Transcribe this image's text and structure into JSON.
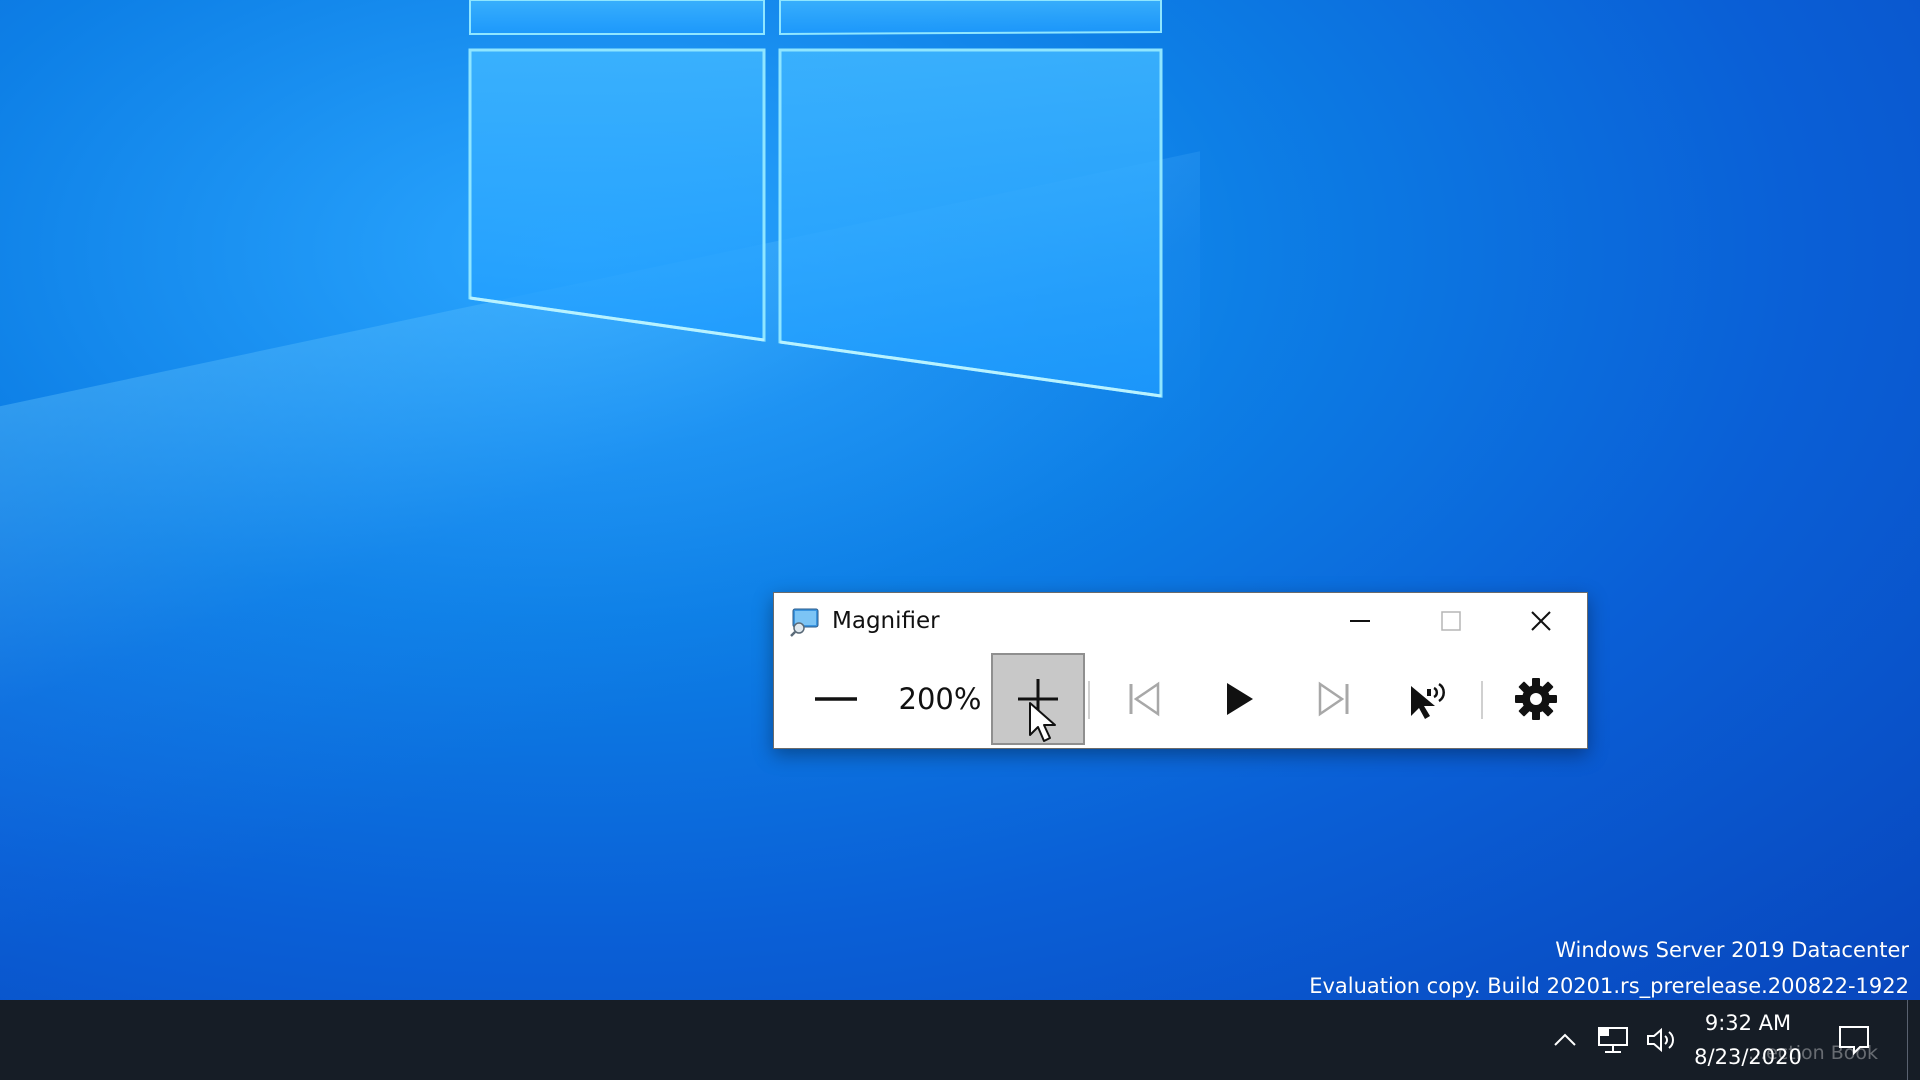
{
  "desktop": {
    "colors": {
      "background_center": "#2aa6ff",
      "background_edge": "#0846bd",
      "logo_glow": "#7fe0ff"
    }
  },
  "magnifier": {
    "title": "Magnifier",
    "app_icon": "magnifier-app-icon",
    "titlebar_buttons": [
      "minimize-icon",
      "maximize-icon",
      "close-icon"
    ],
    "zoom_level": "200%",
    "tools": {
      "zoom_out": "minus-icon",
      "zoom_in": "plus-icon",
      "previous": "skip-previous-icon",
      "play": "play-icon",
      "next": "skip-next-icon",
      "read_from_here": "pointer-speak-icon",
      "settings": "gear-icon"
    },
    "colors": {
      "background": "#ffffff",
      "active_button": "#c8c8c8",
      "disabled_icon": "#a8a8a8"
    }
  },
  "watermark": {
    "line1": "Windows Server 2019 Datacenter",
    "line2": "Evaluation copy. Build 20201.rs_prerelease.200822-1922"
  },
  "taskbar": {
    "background": "#161d26",
    "tray_icons": [
      "chevron-up-icon",
      "network-icon",
      "volume-icon",
      "notification-icon"
    ],
    "clock": {
      "time": "9:32 AM",
      "date": "8/23/2020"
    },
    "ghost_text": "...ection Book"
  }
}
